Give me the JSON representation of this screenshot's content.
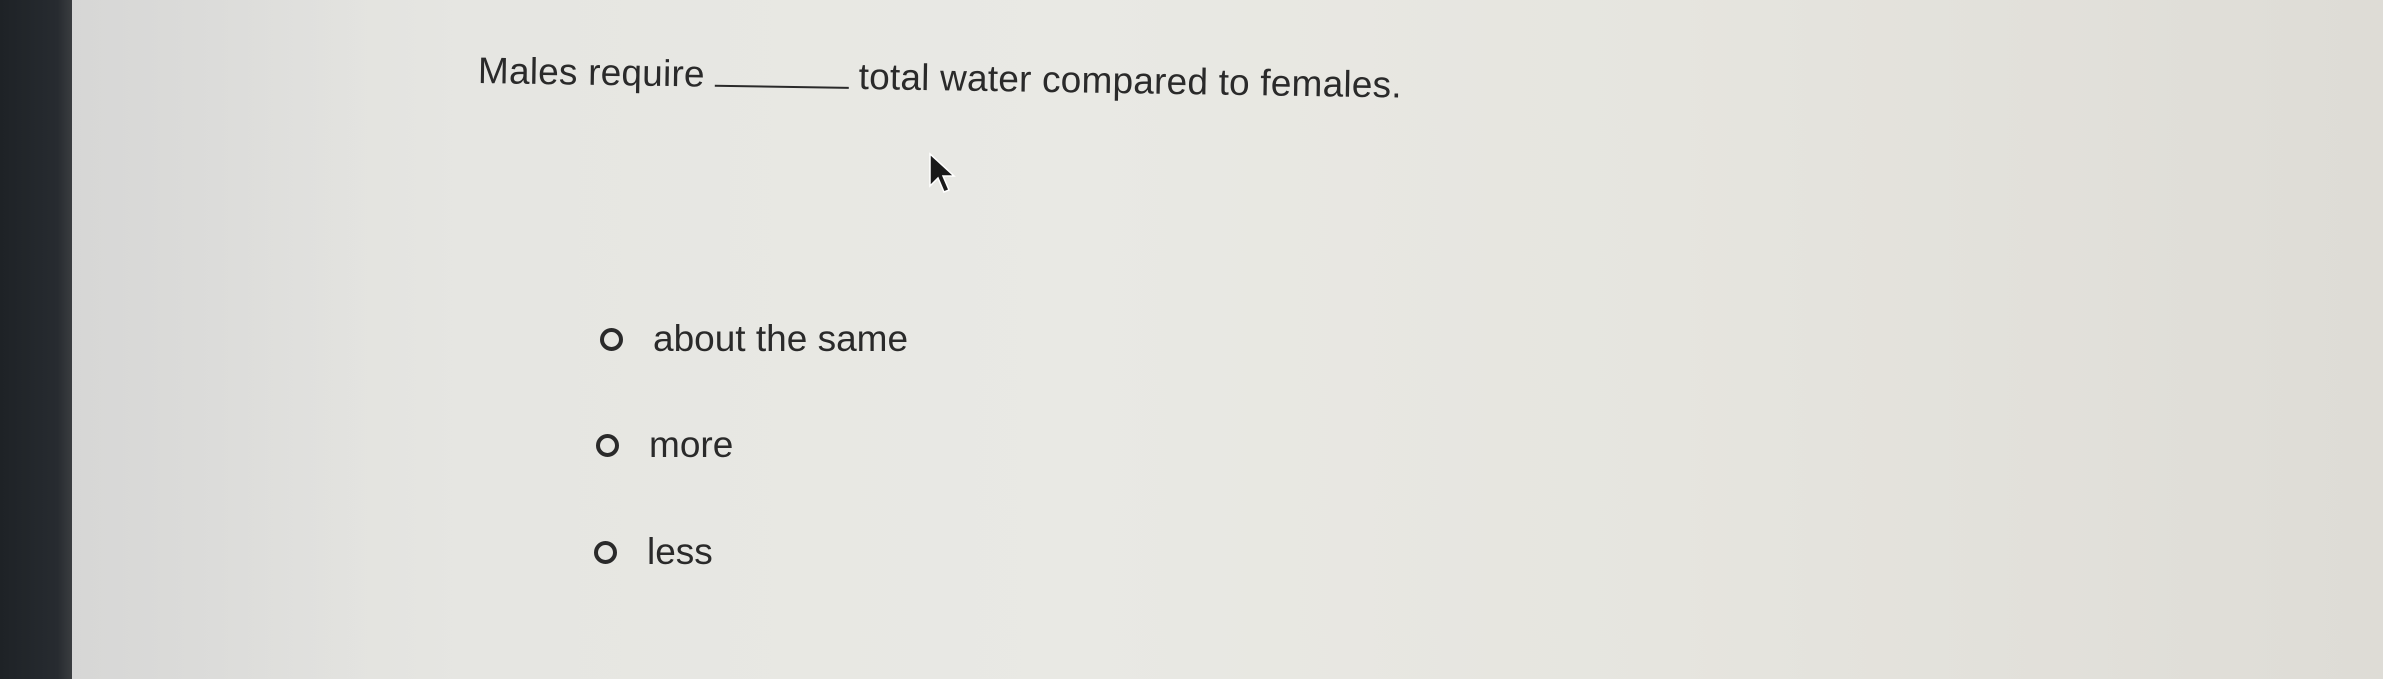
{
  "question": {
    "prefix": "Males require",
    "suffix": "total water compared to females."
  },
  "options": [
    {
      "label": "about the same",
      "selected": false
    },
    {
      "label": "more",
      "selected": false
    },
    {
      "label": "less",
      "selected": false
    }
  ],
  "icons": {
    "cursor": "mouse-pointer-arrow-icon",
    "radio": "radio-button-icon"
  }
}
